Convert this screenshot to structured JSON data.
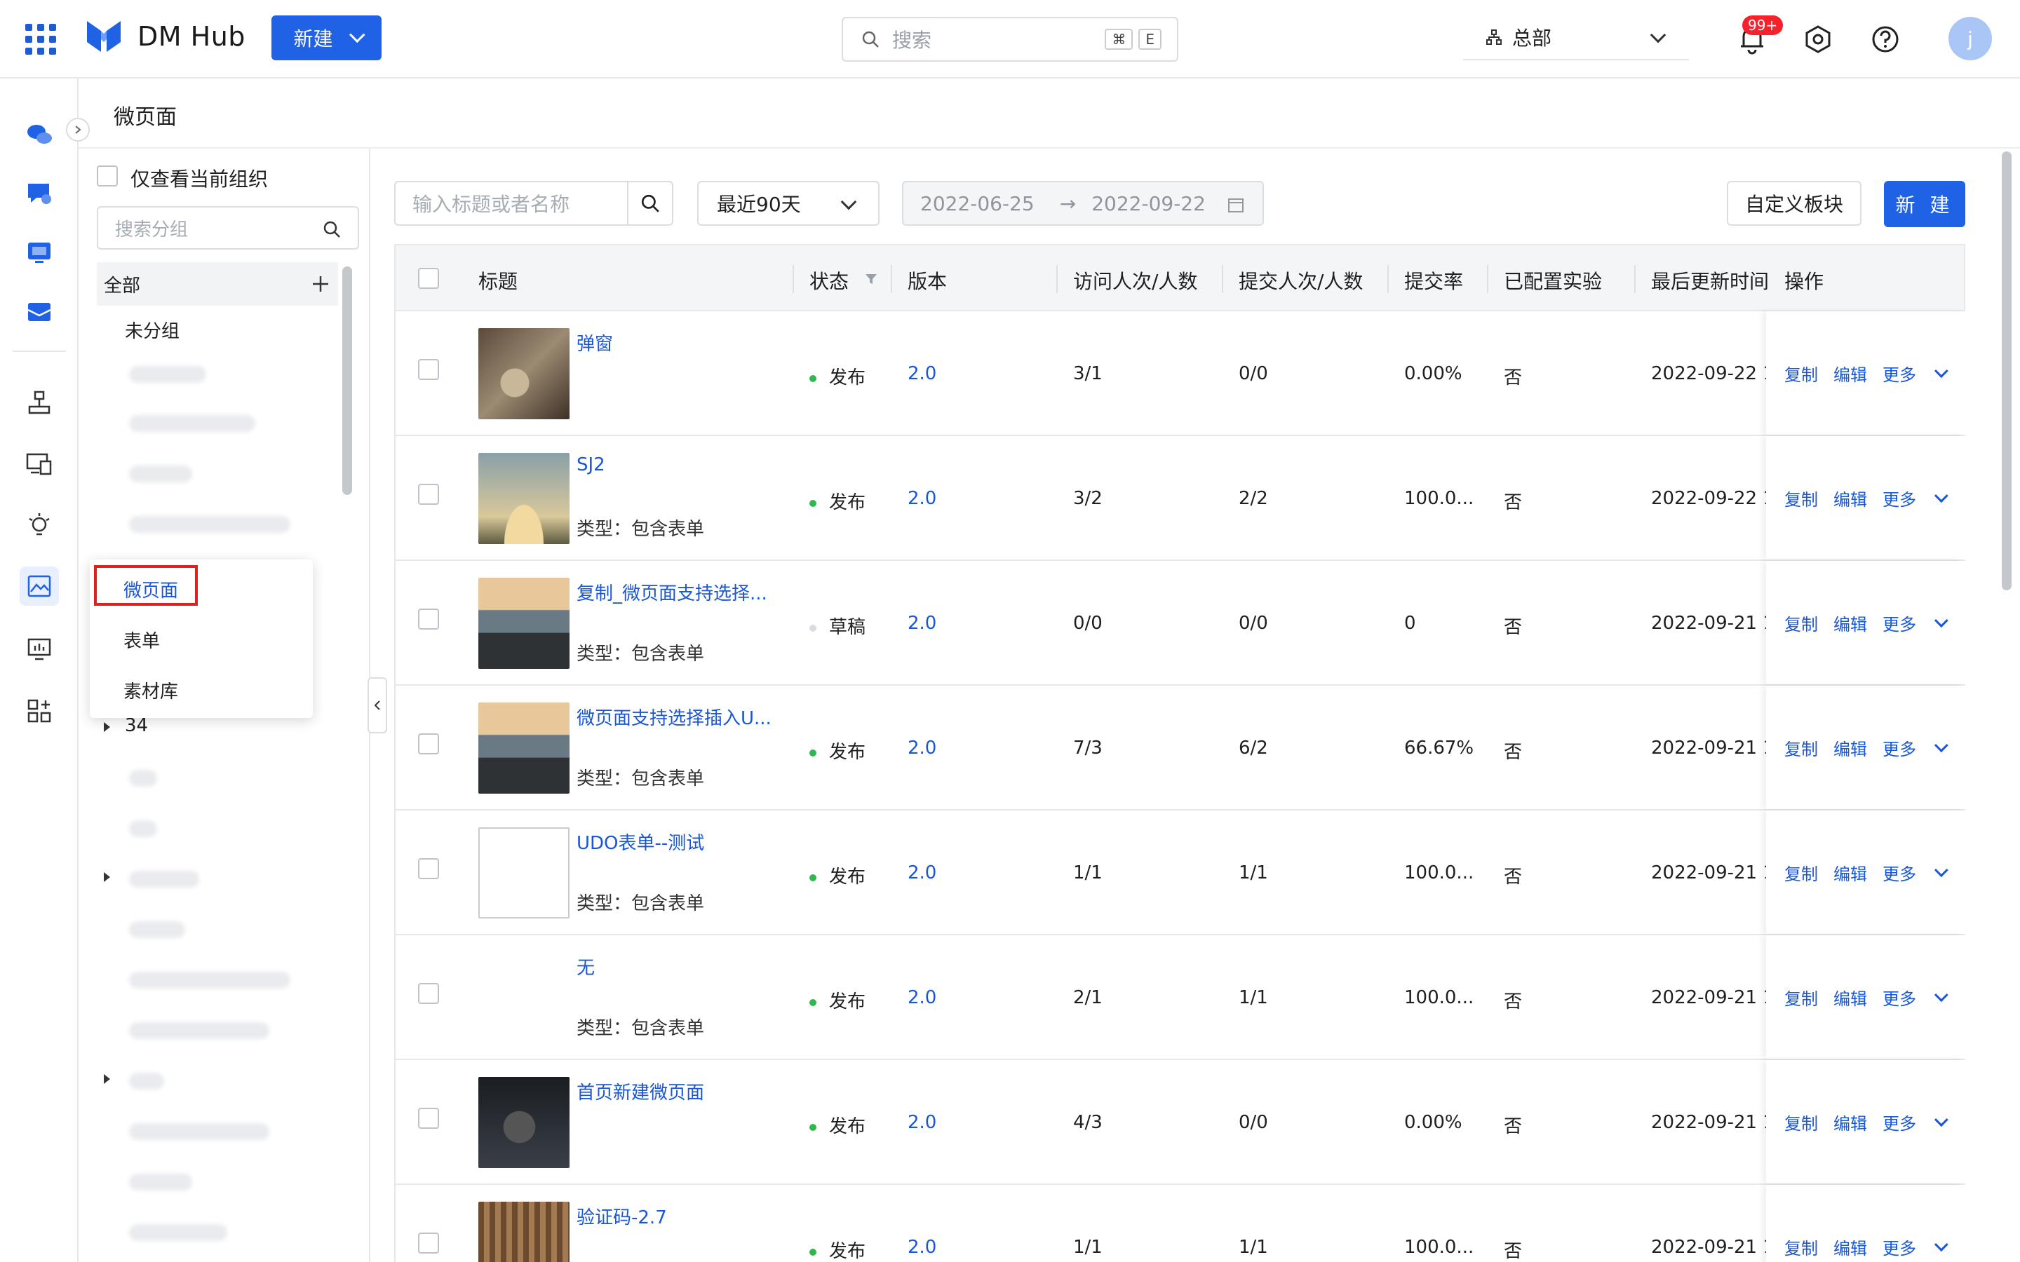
{
  "app": {
    "name": "DM Hub",
    "new_label": "新建"
  },
  "search": {
    "placeholder": "搜索",
    "kbd1": "⌘",
    "kbd2": "E"
  },
  "org": {
    "name": "总部"
  },
  "notifications": {
    "badge": "99+"
  },
  "user": {
    "initial": "j"
  },
  "page": {
    "title": "微页面"
  },
  "groups": {
    "only_current_org": "仅查看当前组织",
    "search_placeholder": "搜索分组",
    "all": "全部",
    "ungrouped": "未分组",
    "visible_group": "34"
  },
  "menu": {
    "items": [
      "微页面",
      "表单",
      "素材库"
    ]
  },
  "filters": {
    "keyword_placeholder": "输入标题或者名称",
    "range": "最近90天",
    "date_start": "2022-06-25",
    "date_sep": "→",
    "date_end": "2022-09-22",
    "custom_block": "自定义板块",
    "create": "新 建"
  },
  "table": {
    "columns": [
      "标题",
      "状态",
      "版本",
      "访问人次/人数",
      "提交人次/人数",
      "提交率",
      "已配置实验",
      "最后更新时间",
      "操作"
    ],
    "op_labels": [
      "复制",
      "编辑",
      "更多"
    ],
    "rows": [
      {
        "title": "弹窗",
        "type": "",
        "status": "发布",
        "status_color": "#2fb84f",
        "version": "2.0",
        "visits": "3/1",
        "submits": "0/0",
        "rate": "0.00%",
        "experiment": "否",
        "updated": "2022-09-22 1"
      },
      {
        "title": "SJ2",
        "type": "类型：包含表单",
        "status": "发布",
        "status_color": "#2fb84f",
        "version": "2.0",
        "visits": "3/2",
        "submits": "2/2",
        "rate": "100.0...",
        "experiment": "否",
        "updated": "2022-09-22 1"
      },
      {
        "title": "复制_微页面支持选择...",
        "type": "类型：包含表单",
        "status": "草稿",
        "status_color": "#d8dbe0",
        "version": "2.0",
        "visits": "0/0",
        "submits": "0/0",
        "rate": "0",
        "experiment": "否",
        "updated": "2022-09-21 1"
      },
      {
        "title": "微页面支持选择插入U...",
        "type": "类型：包含表单",
        "status": "发布",
        "status_color": "#2fb84f",
        "version": "2.0",
        "visits": "7/3",
        "submits": "6/2",
        "rate": "66.67%",
        "experiment": "否",
        "updated": "2022-09-21 1"
      },
      {
        "title": "UDO表单--测试",
        "type": "类型：包含表单",
        "status": "发布",
        "status_color": "#2fb84f",
        "version": "2.0",
        "visits": "1/1",
        "submits": "1/1",
        "rate": "100.0...",
        "experiment": "否",
        "updated": "2022-09-21 1"
      },
      {
        "title": "无",
        "type": "类型：包含表单",
        "status": "发布",
        "status_color": "#2fb84f",
        "version": "2.0",
        "visits": "2/1",
        "submits": "1/1",
        "rate": "100.0...",
        "experiment": "否",
        "updated": "2022-09-21 1"
      },
      {
        "title": "首页新建微页面",
        "type": "",
        "status": "发布",
        "status_color": "#2fb84f",
        "version": "2.0",
        "visits": "4/3",
        "submits": "0/0",
        "rate": "0.00%",
        "experiment": "否",
        "updated": "2022-09-21 1"
      },
      {
        "title": "验证码-2.7",
        "type": "",
        "status": "发布",
        "status_color": "#2fb84f",
        "version": "2.0",
        "visits": "1/1",
        "submits": "1/1",
        "rate": "100.0...",
        "experiment": "否",
        "updated": "2022-09-21 1"
      }
    ]
  }
}
